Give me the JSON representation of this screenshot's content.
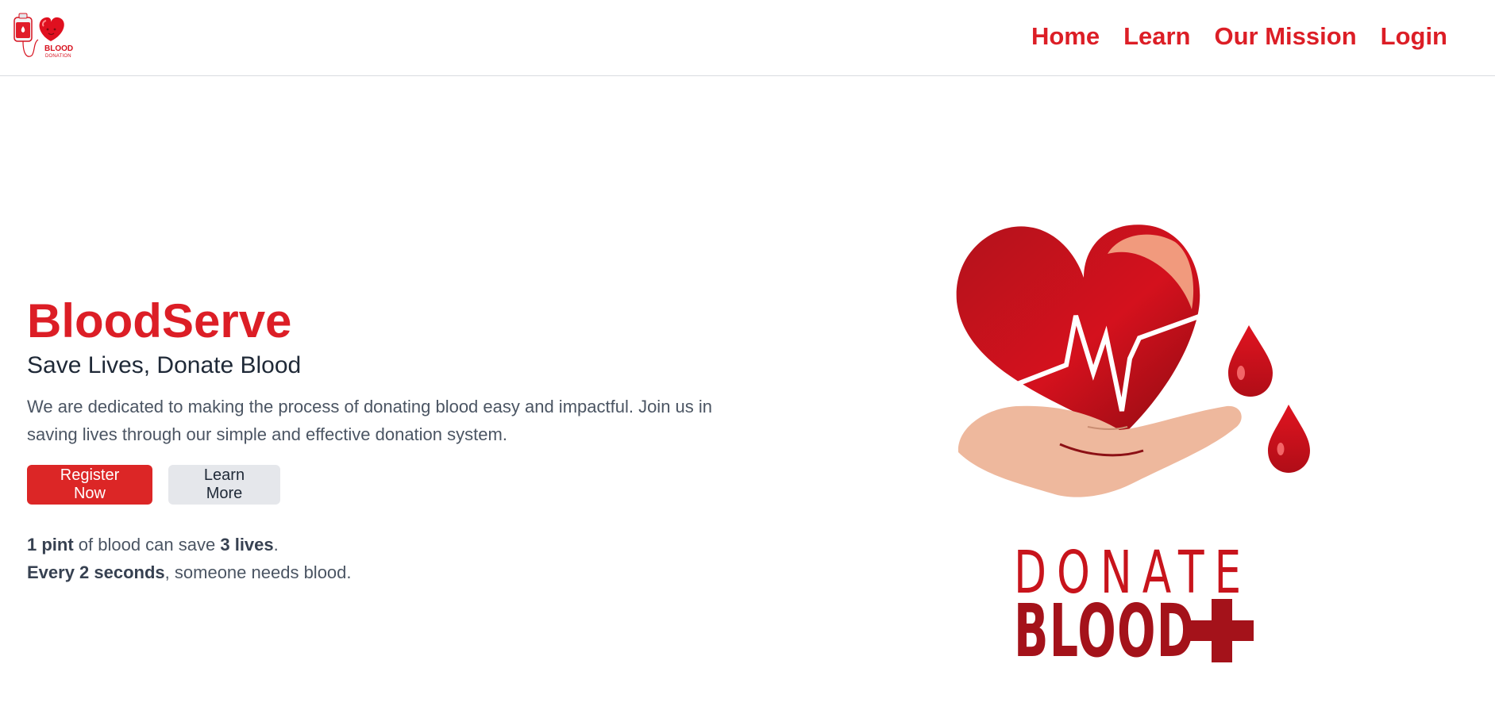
{
  "nav": {
    "logo_text_big": "BLOOD",
    "logo_text_small": "DONATION",
    "links": [
      "Home",
      "Learn",
      "Our Mission",
      "Login"
    ]
  },
  "hero": {
    "title": "BloodServe",
    "subtitle": "Save Lives, Donate Blood",
    "description": "We are dedicated to making the process of donating blood easy and impactful. Join us in saving lives through our simple and effective donation system.",
    "primary_button": "Register Now",
    "secondary_button": "Learn More",
    "stats": {
      "line1_bold1": "1 pint",
      "line1_mid": " of blood can save ",
      "line1_bold2": "3 lives",
      "line1_end": ".",
      "line2_bold": "Every 2 seconds",
      "line2_end": ", someone needs blood."
    }
  },
  "illustration": {
    "word_top": "DONATE",
    "word_bottom": "BLOOD"
  },
  "colors": {
    "brand_red": "#dc1e26",
    "text_dark": "#1f2937",
    "text_gray": "#4b5563",
    "button_gray": "#e5e7eb"
  }
}
